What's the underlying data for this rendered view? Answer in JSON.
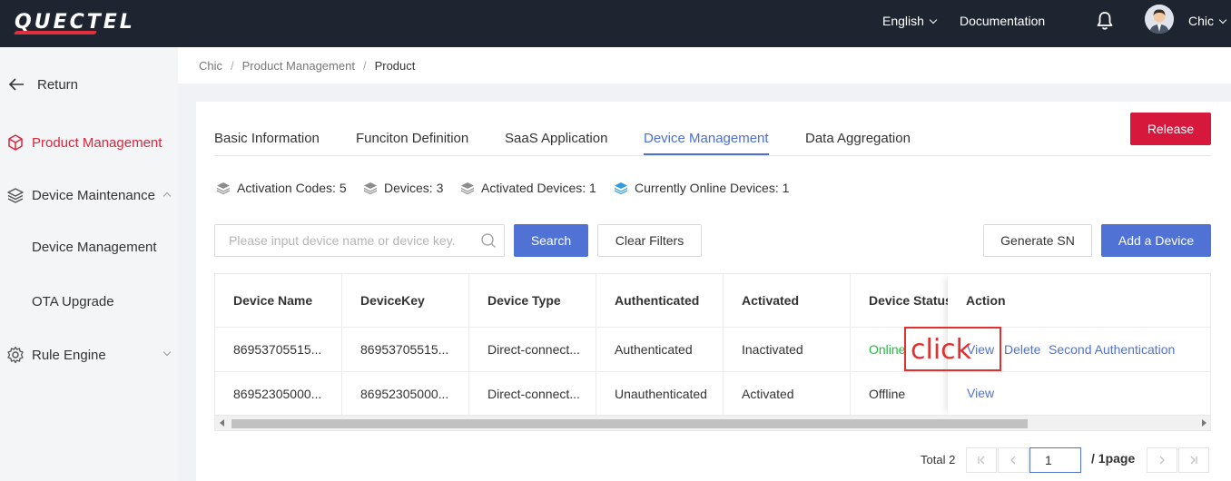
{
  "header": {
    "logo_text": "QUECTEL",
    "language": "English",
    "documentation": "Documentation",
    "user": "Chic"
  },
  "sidebar": {
    "return_label": "Return",
    "items": [
      {
        "label": "Product Management",
        "icon": "cube-icon",
        "active": true
      },
      {
        "label": "Device Maintenance",
        "icon": "layers-icon",
        "expanded": true
      },
      {
        "label": "Device Management",
        "sub": true
      },
      {
        "label": "OTA Upgrade",
        "sub": true
      },
      {
        "label": "Rule Engine",
        "icon": "gear-icon",
        "expanded": false
      }
    ]
  },
  "breadcrumb": [
    "Chic",
    "Product Management",
    "Product"
  ],
  "tabs": [
    {
      "label": "Basic Information"
    },
    {
      "label": "Funciton Definition"
    },
    {
      "label": "SaaS Application"
    },
    {
      "label": "Device Management",
      "active": true
    },
    {
      "label": "Data Aggregation"
    }
  ],
  "release_button": "Release",
  "stats": [
    {
      "label": "Activation Codes: 5"
    },
    {
      "label": "Devices: 3"
    },
    {
      "label": "Activated Devices: 1"
    },
    {
      "label": "Currently Online Devices: 1"
    }
  ],
  "search": {
    "placeholder": "Please input device name or device key.",
    "value": "",
    "search_label": "Search",
    "clear_label": "Clear Filters"
  },
  "generate_sn": "Generate SN",
  "add_device": "Add a Device",
  "table": {
    "columns": [
      "Device Name",
      "DeviceKey",
      "Device Type",
      "Authenticated",
      "Activated",
      "Device Status",
      "Action"
    ],
    "rows": [
      {
        "device_name": "86953705515...",
        "device_key": "86953705515...",
        "device_type": "Direct-connect...",
        "authenticated": "Authenticated",
        "activated": "Inactivated",
        "status": "Online",
        "actions": [
          "View",
          "Delete",
          "Second Authentication"
        ]
      },
      {
        "device_name": "86952305000...",
        "device_key": "86952305000...",
        "device_type": "Direct-connect...",
        "authenticated": "Unauthenticated",
        "activated": "Activated",
        "status": "Offline",
        "actions": [
          "View"
        ]
      }
    ]
  },
  "annotation": "click",
  "pagination": {
    "total": "Total 2",
    "page_value": "1",
    "of_pages": "/ 1page"
  },
  "colors": {
    "accent_blue": "#4f72d4",
    "release_red": "#d6183d",
    "online_green": "#19be3c",
    "nav_dark": "#1e2430"
  }
}
